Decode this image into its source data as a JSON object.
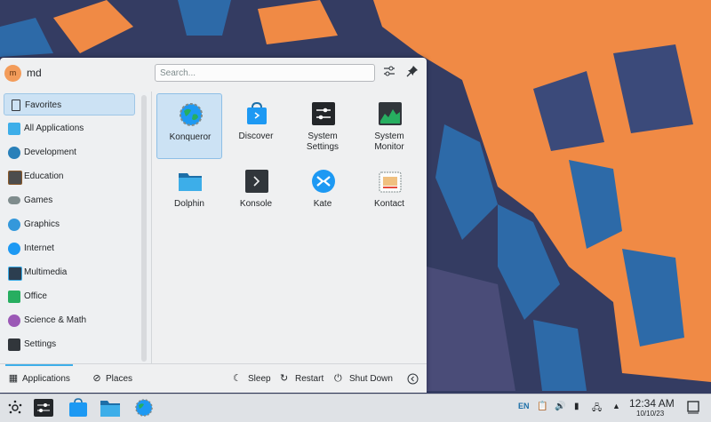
{
  "user": {
    "initial": "m",
    "name": "md"
  },
  "search": {
    "placeholder": "Search..."
  },
  "header_icons": [
    "configure-icon",
    "pin-icon"
  ],
  "categories": [
    {
      "label": "Favorites",
      "icon": "bookmark-icon",
      "active": true
    },
    {
      "label": "All Applications",
      "icon": "grid-icon"
    },
    {
      "label": "Development",
      "icon": "development-icon"
    },
    {
      "label": "Education",
      "icon": "education-icon"
    },
    {
      "label": "Games",
      "icon": "gamepad-icon"
    },
    {
      "label": "Graphics",
      "icon": "graphics-icon"
    },
    {
      "label": "Internet",
      "icon": "globe-icon"
    },
    {
      "label": "Multimedia",
      "icon": "multimedia-icon"
    },
    {
      "label": "Office",
      "icon": "office-icon"
    },
    {
      "label": "Science & Math",
      "icon": "science-icon"
    },
    {
      "label": "Settings",
      "icon": "settings-icon"
    }
  ],
  "apps": [
    {
      "label": "Konqueror",
      "icon": "konqueror-icon",
      "selected": true
    },
    {
      "label": "Discover",
      "icon": "discover-icon"
    },
    {
      "label": "System\nSettings",
      "label_line1": "System",
      "label_line2": "Settings",
      "icon": "system-settings-icon"
    },
    {
      "label_line1": "System",
      "label_line2": "Monitor",
      "icon": "system-monitor-icon"
    },
    {
      "label": "Dolphin",
      "icon": "folder-icon"
    },
    {
      "label": "Konsole",
      "icon": "terminal-icon"
    },
    {
      "label": "Kate",
      "icon": "kate-icon"
    },
    {
      "label": "Kontact",
      "icon": "kontact-icon"
    }
  ],
  "footer": {
    "tabs": [
      {
        "label": "Applications",
        "icon": "applications-icon",
        "active": true
      },
      {
        "label": "Places",
        "icon": "places-icon"
      }
    ],
    "actions": [
      {
        "label": "Sleep",
        "icon": "sleep-icon"
      },
      {
        "label": "Restart",
        "icon": "restart-icon"
      },
      {
        "label": "Shut Down",
        "icon": "shutdown-icon"
      }
    ]
  },
  "taskbar": {
    "launcher_icon": "kde-launcher-icon",
    "tasks": [
      "system-settings-icon",
      "discover-icon",
      "folder-icon",
      "konqueror-icon"
    ],
    "tray": {
      "language": "EN",
      "icons": [
        "clipboard-icon",
        "volume-icon",
        "usb-icon",
        "network-icon",
        "expand-tray-icon"
      ]
    },
    "clock": {
      "time": "12:34 AM",
      "date": "10/10/23"
    },
    "show_desktop_icon": "show-desktop-icon"
  },
  "colors": {
    "accent": "#3daee9",
    "selection_bg": "#cce2f4",
    "wallpaper_orange": "#f08a45",
    "wallpaper_blue": "#2d6aa8",
    "wallpaper_dark": "#343c62"
  }
}
